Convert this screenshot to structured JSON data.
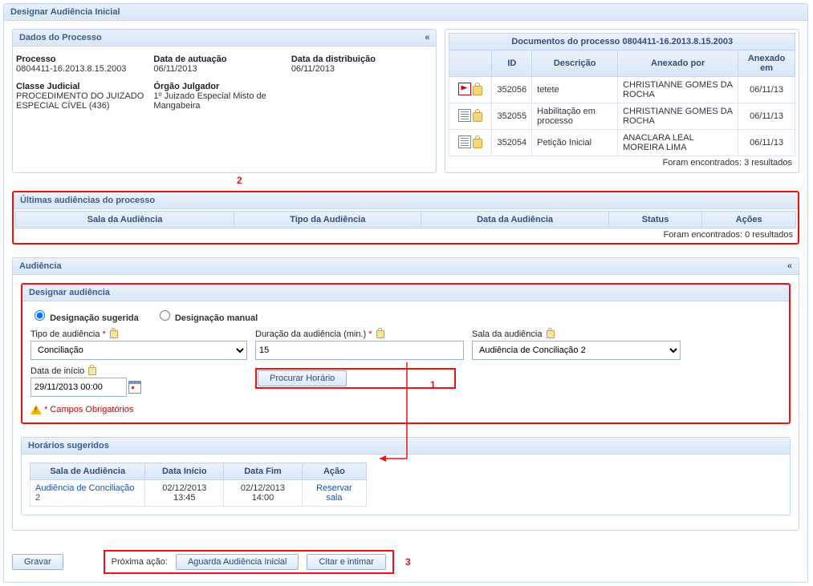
{
  "title": "Designar Audiência Inicial",
  "dados": {
    "header": "Dados do Processo",
    "processo_label": "Processo",
    "processo_value": "0804411-16.2013.8.15.2003",
    "autuacao_label": "Data de autuação",
    "autuacao_value": "06/11/2013",
    "distrib_label": "Data da distribuição",
    "distrib_value": "06/11/2013",
    "classe_label": "Classe Judicial",
    "classe_value": "PROCEDIMENTO DO JUIZADO ESPECIAL CÍVEL (436)",
    "orgao_label": "Órgão Julgador",
    "orgao_value": "1º Juizado Especial Misto de Mangabeira"
  },
  "docs": {
    "caption": "Documentos do processo 0804411-16.2013.8.15.2003",
    "cols": {
      "id": "ID",
      "desc": "Descrição",
      "anex_por": "Anexado por",
      "anex_em": "Anexado em"
    },
    "rows": [
      {
        "id": "352056",
        "desc": "tetete",
        "por": "CHRISTIANNE GOMES DA ROCHA",
        "em": "06/11/13",
        "kind": "pdf"
      },
      {
        "id": "352055",
        "desc": "Habilitação em processo",
        "por": "CHRISTIANNE GOMES DA ROCHA",
        "em": "06/11/13",
        "kind": "doc"
      },
      {
        "id": "352054",
        "desc": "Petição Inicial",
        "por": "ANACLARA LEAL MOREIRA LIMA",
        "em": "06/11/13",
        "kind": "doc"
      }
    ],
    "footer": "Foram encontrados: 3 resultados"
  },
  "ultimas": {
    "header": "Últimas audiências do processo",
    "cols": {
      "sala": "Sala da Audiência",
      "tipo": "Tipo da Audiência",
      "data": "Data da Audiência",
      "status": "Status",
      "acoes": "Ações"
    },
    "footer": "Foram encontrados: 0 resultados"
  },
  "audiencia": {
    "header": "Audiência",
    "designar_header": "Designar audiência",
    "radio_sugerida": "Designação sugerida",
    "radio_manual": "Designação manual",
    "tipo_label": "Tipo de audiência",
    "tipo_value": "Conciliação",
    "duracao_label": "Duração da audiência (min.)",
    "duracao_value": "15",
    "sala_label": "Sala da audiência",
    "sala_value": "Audiência de Conciliação 2",
    "data_inicio_label": "Data de início",
    "data_inicio_value": "29/11/2013 00:00",
    "procurar_btn": "Procurar Horário",
    "campos_obrig": "* Campos Obrigatórios",
    "horarios_header": "Horários sugeridos",
    "hcols": {
      "sala": "Sala de Audiência",
      "inicio": "Data Início",
      "fim": "Data Fim",
      "acao": "Ação"
    },
    "hrow": {
      "sala": "Audiência de Conciliação 2",
      "inicio": "02/12/2013 13:45",
      "fim": "02/12/2013 14:00",
      "acao": "Reservar sala"
    }
  },
  "bottom": {
    "gravar": "Gravar",
    "proxima": "Próxima ação:",
    "aguarda": "Aguarda Audiência Inicial",
    "citar": "Citar e intimar"
  },
  "nums": {
    "n1": "1",
    "n2": "2",
    "n3": "3"
  }
}
